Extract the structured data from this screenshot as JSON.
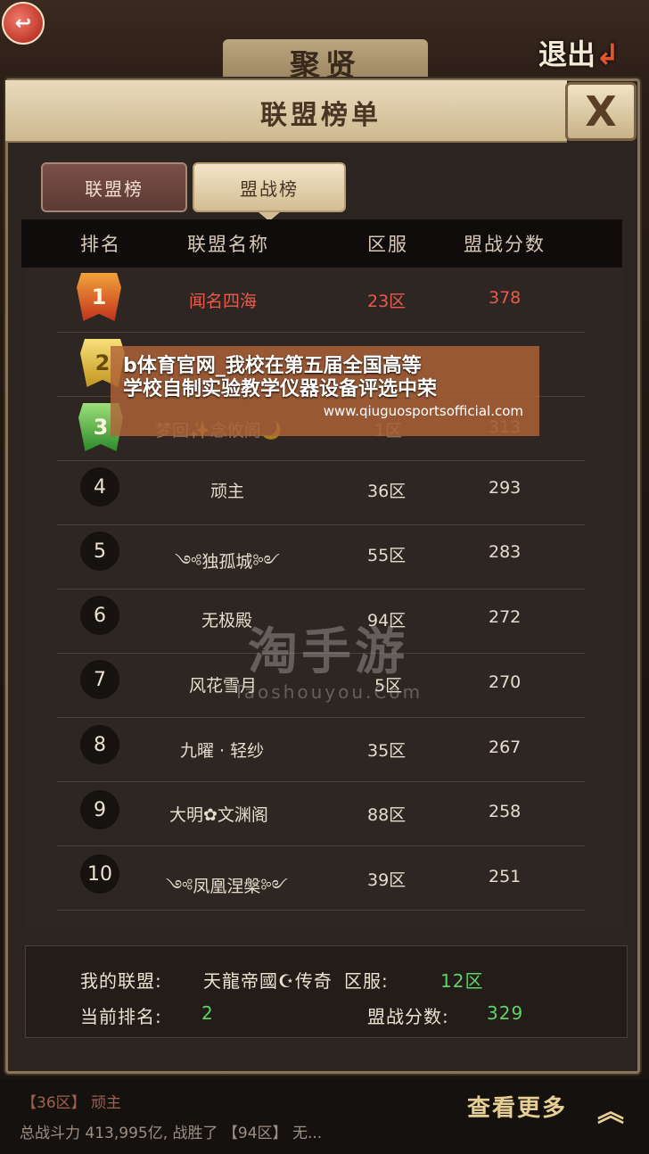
{
  "top_bar": {
    "back_icon": "back-arrow-icon",
    "exit_label": "退出",
    "exit_icon": "exit-arrow-icon"
  },
  "panel": {
    "title": "联盟榜单",
    "close_label": "X"
  },
  "tabs": [
    {
      "label": "联盟榜",
      "active": false
    },
    {
      "label": "盟战榜",
      "active": true
    }
  ],
  "table": {
    "headers": {
      "rank": "排名",
      "name": "联盟名称",
      "server": "区服",
      "score": "盟战分数"
    },
    "rows": [
      {
        "rank": "1",
        "name": "闻名四海",
        "server": "23区",
        "score": "378"
      },
      {
        "rank": "2",
        "name": "",
        "server": "",
        "score": ""
      },
      {
        "rank": "3",
        "name": "梦回✨念攸阁🌙",
        "server": "1区",
        "score": "313"
      },
      {
        "rank": "4",
        "name": "顽主",
        "server": "36区",
        "score": "293"
      },
      {
        "rank": "5",
        "name": "༺独孤城༻",
        "server": "55区",
        "score": "283"
      },
      {
        "rank": "6",
        "name": "无极殿",
        "server": "94区",
        "score": "272"
      },
      {
        "rank": "7",
        "name": "风花雪月",
        "server": "5区",
        "score": "270"
      },
      {
        "rank": "8",
        "name": "九曜 · 轻纱",
        "server": "35区",
        "score": "267"
      },
      {
        "rank": "9",
        "name": "大明✿文渊阁",
        "server": "88区",
        "score": "258"
      },
      {
        "rank": "10",
        "name": "༺凤凰涅槃༻",
        "server": "39区",
        "score": "251"
      }
    ]
  },
  "ad_overlay": {
    "line1": "b体育官网_我校在第五届全国高等",
    "line2": "学校自制实验教学仪器设备评选中荣",
    "url": "www.qiuguosportsofficial.com"
  },
  "watermark": {
    "big": "淘手游",
    "small": "Taoshouyou.Com"
  },
  "my_alliance": {
    "label": "我的联盟:",
    "name": "天龍帝國☪传奇",
    "server_label": "区服:",
    "server": "12区",
    "rank_label": "当前排名:",
    "rank": "2",
    "score_label": "盟战分数:",
    "score": "329"
  },
  "ticker": {
    "line1": "【36区】 顽主",
    "line2": "总战斗力 413,995亿, 战胜了 【94区】 无...",
    "more_label": "查看更多",
    "more_icon": "double-chevron-up-icon"
  }
}
